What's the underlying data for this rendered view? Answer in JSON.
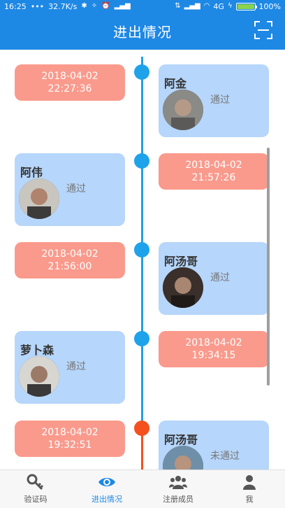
{
  "status_bar": {
    "time": "16:25",
    "dots": "•••",
    "speed": "32.7K/s",
    "network": "4G",
    "battery": "100%",
    "battery_level": 1.0
  },
  "app_bar": {
    "title": "进出情况",
    "scan_icon": "scan-icon"
  },
  "timeline": [
    {
      "date": "2018-04-02",
      "time": "22:27:36",
      "name": "阿金",
      "status": "通过",
      "side": "right",
      "passed": true
    },
    {
      "date": "2018-04-02",
      "time": "21:57:26",
      "name": "阿伟",
      "status": "通过",
      "side": "left",
      "passed": true
    },
    {
      "date": "2018-04-02",
      "time": "21:56:00",
      "name": "阿汤哥",
      "status": "通过",
      "side": "right",
      "passed": true
    },
    {
      "date": "2018-04-02",
      "time": "19:34:15",
      "name": "萝卜森",
      "status": "通过",
      "side": "left",
      "passed": true
    },
    {
      "date": "2018-04-02",
      "time": "19:32:51",
      "name": "阿汤哥",
      "status": "未通过",
      "side": "right",
      "passed": false
    }
  ],
  "colors": {
    "primary": "#1e88e5",
    "date_card": "#fa9a8c",
    "person_card": "#b6d6fb",
    "timeline_blue": "#1ea3ea",
    "timeline_red": "#f4511e"
  },
  "bottom_nav": [
    {
      "label": "验证码",
      "icon": "key-icon",
      "active": false
    },
    {
      "label": "进出情况",
      "icon": "eye-icon",
      "active": true
    },
    {
      "label": "注册成员",
      "icon": "group-icon",
      "active": false
    },
    {
      "label": "我",
      "icon": "user-icon",
      "active": false
    }
  ]
}
